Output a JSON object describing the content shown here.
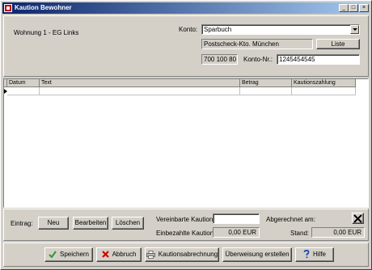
{
  "window": {
    "title": "Kaution Bewohner"
  },
  "header": {
    "unit": "Wohnung 1 - EG Links",
    "konto_label": "Konto:",
    "konto_value": "Sparbuch",
    "bank_name": "Postscheck-Kto. München",
    "liste_label": "Liste",
    "blz": "700 100 80",
    "kontonr_label": "Konto-Nr.:",
    "kontonr_value": "1245454545"
  },
  "grid": {
    "columns": [
      "Datum",
      "Text",
      "Betrag",
      "Kautionszahlung"
    ]
  },
  "entry": {
    "label": "Eintrag:",
    "neu": "Neu",
    "bearbeiten": "Bearbeiten",
    "loeschen": "Löschen"
  },
  "summary": {
    "vereinbarte_label": "Vereinbarte Kaution:",
    "vereinbarte_value": "",
    "abgerechnet_label": "Abgerechnet am:",
    "eingezahlt_label": "Einbezahlte Kaution:",
    "eingezahlt_value": "0,00 EUR",
    "stand_label": "Stand:",
    "stand_value": "0,00 EUR"
  },
  "actions": {
    "speichern": "Speichern",
    "abbruch": "Abbruch",
    "abrechnung": "Kautionsabrechnung",
    "ueberweisung": "Überweisung erstellen",
    "hilfe": "Hilfe"
  },
  "icons": {
    "title": "app-icon",
    "speichern": "checkmark-icon",
    "abbruch": "red-x-icon",
    "abrechnung": "printer-icon",
    "hilfe": "question-icon",
    "clear": "black-x-icon"
  },
  "colors": {
    "titlebar_start": "#0a246a",
    "titlebar_end": "#a6caf0",
    "face": "#d4d0c8"
  }
}
